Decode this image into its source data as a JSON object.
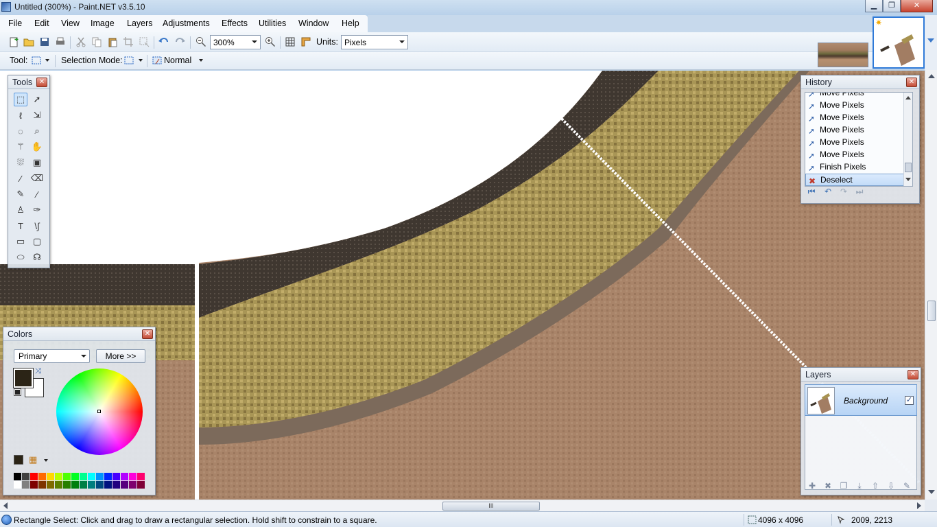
{
  "window": {
    "title": "Untitled (300%) - Paint.NET v3.5.10",
    "minimize_glyph": "▁",
    "maximize_glyph": "❐",
    "close_glyph": "✕"
  },
  "menu": [
    "File",
    "Edit",
    "View",
    "Image",
    "Layers",
    "Adjustments",
    "Effects",
    "Utilities",
    "Window",
    "Help"
  ],
  "toolbar": {
    "zoom_value": "300%",
    "units_label": "Units:",
    "units_value": "Pixels"
  },
  "toolbar2": {
    "tool_label": "Tool:",
    "selection_mode_label": "Selection Mode:",
    "blend_mode": "Normal"
  },
  "tools_panel": {
    "title": "Tools",
    "close": "✕"
  },
  "history_panel": {
    "title": "History",
    "close": "✕",
    "items": [
      "Move Pixels",
      "Move Pixels",
      "Move Pixels",
      "Move Pixels",
      "Move Pixels",
      "Move Pixels",
      "Finish Pixels",
      "Deselect"
    ],
    "selected_index": 7
  },
  "layers_panel": {
    "title": "Layers",
    "close": "✕",
    "layers": [
      {
        "name": "Background",
        "visible": true
      }
    ]
  },
  "colors_panel": {
    "title": "Colors",
    "close": "✕",
    "primary_select": "Primary",
    "more_button": "More >>",
    "primary_color": "#2b2416",
    "secondary_color": "#ffffff",
    "palette_top": [
      "#000000",
      "#404040",
      "#ff0000",
      "#ff6a00",
      "#ffd800",
      "#b6ff00",
      "#4cff00",
      "#00ff21",
      "#00ff90",
      "#00ffff",
      "#0094ff",
      "#0026ff",
      "#4800ff",
      "#b200ff",
      "#ff00dc",
      "#ff006e"
    ],
    "palette_bottom": [
      "#ffffff",
      "#808080",
      "#7f0000",
      "#7f3300",
      "#7f6a00",
      "#5b7f00",
      "#267f00",
      "#007f0e",
      "#007f46",
      "#007f7f",
      "#004a7f",
      "#00137f",
      "#21007f",
      "#57007f",
      "#7f006e",
      "#7f0037"
    ]
  },
  "status": {
    "hint": "Rectangle Select: Click and drag to draw a rectangular selection. Hold shift to constrain to a square.",
    "image_size": "4096 x 4096",
    "cursor_pos": "2009, 2213"
  },
  "scrollbar": {
    "grip": "III"
  },
  "colors": {
    "accent": "#2f7ad8",
    "dirt": "#a27d63",
    "grass": "#a79250",
    "asphalt": "#3c342c"
  }
}
